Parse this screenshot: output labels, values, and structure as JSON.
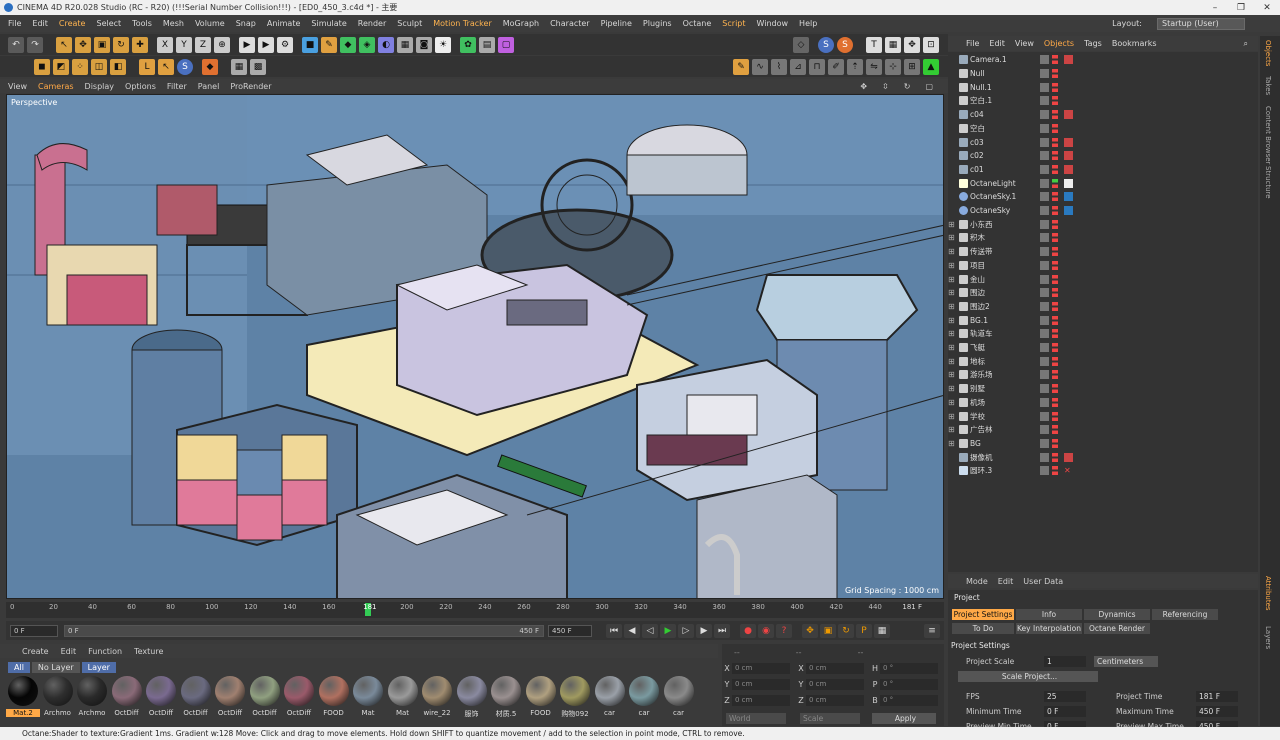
{
  "window": {
    "title": "CINEMA 4D R20.028 Studio (RC - R20) (!!!Serial Number Collision!!!) - [ED0_450_3.c4d *] - 主要"
  },
  "menubar": [
    "File",
    "Edit",
    "Create",
    "Select",
    "Tools",
    "Mesh",
    "Volume",
    "Snap",
    "Animate",
    "Simulate",
    "Render",
    "Sculpt",
    "Motion Tracker",
    "MoGraph",
    "Character",
    "Pipeline",
    "Plugins",
    "Octane",
    "Script",
    "Window",
    "Help"
  ],
  "layout": {
    "label": "Layout:",
    "value": "Startup (User)"
  },
  "viewport": {
    "menu": [
      "View",
      "Cameras",
      "Display",
      "Options",
      "Filter",
      "Panel",
      "ProRender"
    ],
    "label": "Perspective",
    "grid_spacing": "Grid Spacing : 1000 cm"
  },
  "timeline": {
    "ticks": [
      "0",
      "20",
      "40",
      "60",
      "80",
      "100",
      "120",
      "140",
      "160",
      "181",
      "200",
      "220",
      "240",
      "260",
      "280",
      "300",
      "320",
      "340",
      "360",
      "380",
      "400",
      "420",
      "440"
    ],
    "frame_end": "181 F",
    "current_frame": 181,
    "max_frame": 450
  },
  "transport": {
    "start": "0 F",
    "range_start": "0 F",
    "range_end": "450 F",
    "end": "450 F"
  },
  "materials": {
    "menu": [
      "Create",
      "Edit",
      "Function",
      "Texture"
    ],
    "filters": [
      "All",
      "No Layer",
      "Layer"
    ],
    "items": [
      {
        "name": "Mat.2",
        "color": "#050505"
      },
      {
        "name": "Archmo",
        "color": "#2e2e2e"
      },
      {
        "name": "Archmo",
        "color": "#2a2a2a"
      },
      {
        "name": "OctDiff",
        "color": "#8a6a78"
      },
      {
        "name": "OctDiff",
        "color": "#7a6a90"
      },
      {
        "name": "OctDiff",
        "color": "#6a6a80"
      },
      {
        "name": "OctDiff",
        "color": "#a08070"
      },
      {
        "name": "OctDiff",
        "color": "#90a080"
      },
      {
        "name": "OctDiff",
        "color": "#9a5a6a"
      },
      {
        "name": "FOOD",
        "color": "#b07060"
      },
      {
        "name": "Mat",
        "color": "#7a8a9a"
      },
      {
        "name": "Mat",
        "color": "#9a9a9a"
      },
      {
        "name": "wire_22",
        "color": "#a08c70"
      },
      {
        "name": "服饰",
        "color": "#8a8aa0"
      },
      {
        "name": "材质.5",
        "color": "#9a9090"
      },
      {
        "name": "FOOD",
        "color": "#b0a080"
      },
      {
        "name": "购物092",
        "color": "#a09a60"
      },
      {
        "name": "car",
        "color": "#9aa0a8"
      },
      {
        "name": "car",
        "color": "#7a9aa0"
      },
      {
        "name": "car",
        "color": "#8a8a8a"
      }
    ]
  },
  "coords": {
    "header": [
      "--",
      "--",
      "--"
    ],
    "rows": [
      {
        "a": "X",
        "av": "0 cm",
        "b": "X",
        "bv": "0 cm",
        "c": "H",
        "cv": "0 °"
      },
      {
        "a": "Y",
        "av": "0 cm",
        "b": "Y",
        "bv": "0 cm",
        "c": "P",
        "cv": "0 °"
      },
      {
        "a": "Z",
        "av": "0 cm",
        "b": "Z",
        "bv": "0 cm",
        "c": "B",
        "cv": "0 °"
      }
    ],
    "world": "World",
    "scale": "Scale",
    "apply": "Apply"
  },
  "object_manager": {
    "menu": [
      "File",
      "Edit",
      "View",
      "Objects",
      "Tags",
      "Bookmarks"
    ],
    "objects": [
      {
        "name": "Camera.1",
        "type": "camera"
      },
      {
        "name": "Null",
        "type": "null"
      },
      {
        "name": "Null.1",
        "type": "null"
      },
      {
        "name": "空白.1",
        "type": "null"
      },
      {
        "name": "c04",
        "type": "camera"
      },
      {
        "name": "空白",
        "type": "null"
      },
      {
        "name": "c03",
        "type": "camera"
      },
      {
        "name": "c02",
        "type": "camera"
      },
      {
        "name": "c01",
        "type": "camera"
      },
      {
        "name": "OctaneLight",
        "type": "light"
      },
      {
        "name": "OctaneSky.1",
        "type": "sky"
      },
      {
        "name": "OctaneSky",
        "type": "sky"
      },
      {
        "name": "小东西",
        "type": "null"
      },
      {
        "name": "积木",
        "type": "null"
      },
      {
        "name": "传送带",
        "type": "null"
      },
      {
        "name": "项目",
        "type": "null"
      },
      {
        "name": "金山",
        "type": "null"
      },
      {
        "name": "围边",
        "type": "null"
      },
      {
        "name": "围边2",
        "type": "null"
      },
      {
        "name": "BG.1",
        "type": "null"
      },
      {
        "name": "轨道车",
        "type": "null"
      },
      {
        "name": "飞艇",
        "type": "null"
      },
      {
        "name": "地标",
        "type": "null"
      },
      {
        "name": "游乐场",
        "type": "null"
      },
      {
        "name": "别墅",
        "type": "null"
      },
      {
        "name": "机场",
        "type": "null"
      },
      {
        "name": "学校",
        "type": "null"
      },
      {
        "name": "广告林",
        "type": "null"
      },
      {
        "name": "BG",
        "type": "null"
      },
      {
        "name": "摄像机",
        "type": "camera"
      },
      {
        "name": "圆环.3",
        "type": "spline"
      }
    ]
  },
  "side_tabs": [
    "Objects",
    "Takes",
    "Content Browser",
    "Structure",
    "Attributes",
    "Layers"
  ],
  "attributes": {
    "menu": [
      "Mode",
      "Edit",
      "User Data"
    ],
    "title": "Project",
    "tabs_row1": [
      "Project Settings",
      "Info",
      "Dynamics",
      "Referencing"
    ],
    "tabs_row2": [
      "To Do",
      "Key Interpolation",
      "Octane Render"
    ],
    "section": "Project Settings",
    "project_scale_label": "Project Scale",
    "project_scale_value": "1",
    "project_scale_unit": "Centimeters",
    "scale_button": "Scale Project...",
    "fps_label": "FPS",
    "fps": "25",
    "min_time_label": "Minimum Time",
    "min_time": "0 F",
    "preview_min_label": "Preview Min Time",
    "preview_min": "0 F",
    "project_time_label": "Project Time",
    "project_time": "181 F",
    "max_time_label": "Maximum Time",
    "max_time": "450 F",
    "preview_max_label": "Preview Max Time",
    "preview_max": "450 F"
  },
  "statusbar": "Octane:Shader to texture:Gradient  1ms. Gradient w:128      Move: Click and drag to move elements. Hold down SHIFT to quantize movement / add to the selection in point mode, CTRL to remove."
}
